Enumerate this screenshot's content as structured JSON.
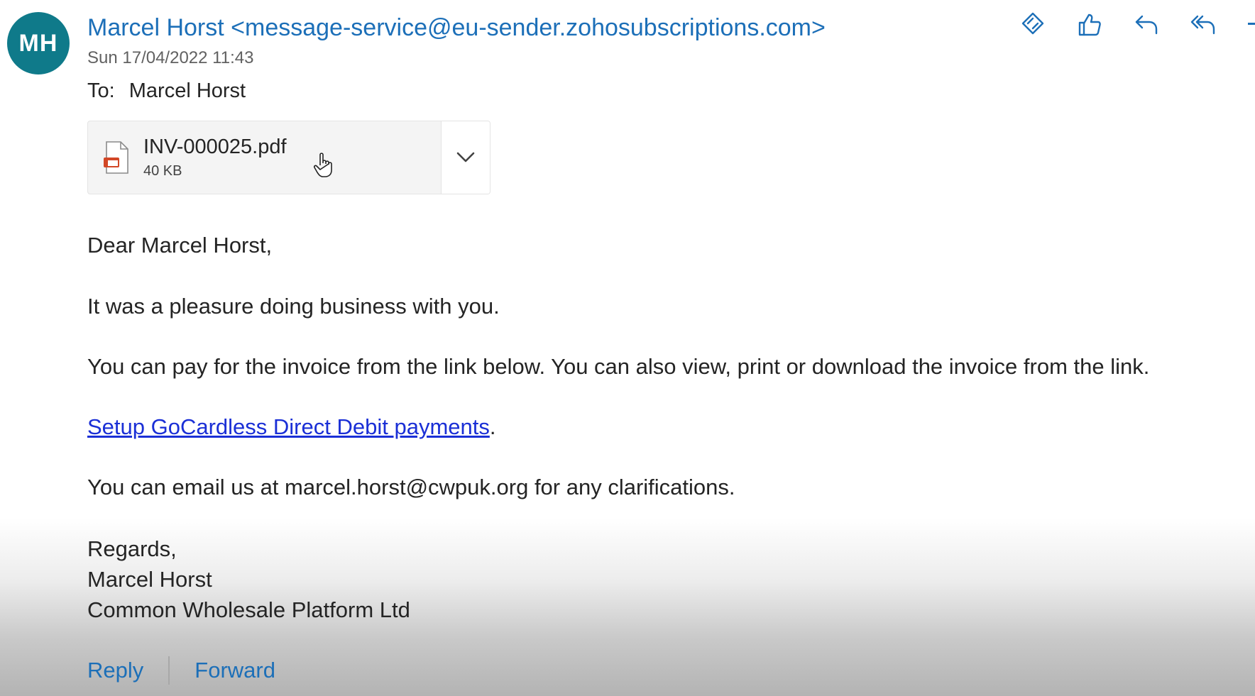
{
  "avatar": {
    "initials": "MH",
    "color": "#0f7a8a"
  },
  "sender": {
    "name": "Marcel Horst",
    "email": "<message-service@eu-sender.zohosubscriptions.com>"
  },
  "date": "Sun 17/04/2022 11:43",
  "to": {
    "label": "To:",
    "recipient": "Marcel Horst"
  },
  "toolbar": {
    "icons": [
      "immersive-reader-icon",
      "thumbs-up-icon",
      "reply-icon",
      "reply-all-icon"
    ]
  },
  "attachment": {
    "file_name": "INV-000025.pdf",
    "file_size": "40 KB",
    "icon": "pdf-file-icon"
  },
  "body": {
    "greeting": "Dear Marcel Horst,",
    "line1": "It was a pleasure doing business with you.",
    "line2": "You can pay for the invoice from the link below. You can also view, print or download the invoice from the link.",
    "link_text": "Setup GoCardless Direct Debit payments",
    "link_suffix": ".",
    "line3": "You can email us at marcel.horst@cwpuk.org for any clarifications.",
    "signoff": "Regards,",
    "signature_name": "Marcel Horst",
    "signature_company": "Common Wholesale Platform Ltd"
  },
  "footer": {
    "reply_label": "Reply",
    "forward_label": "Forward"
  },
  "colors": {
    "accent": "#1c6fb8",
    "link": "#1a2fd6"
  }
}
